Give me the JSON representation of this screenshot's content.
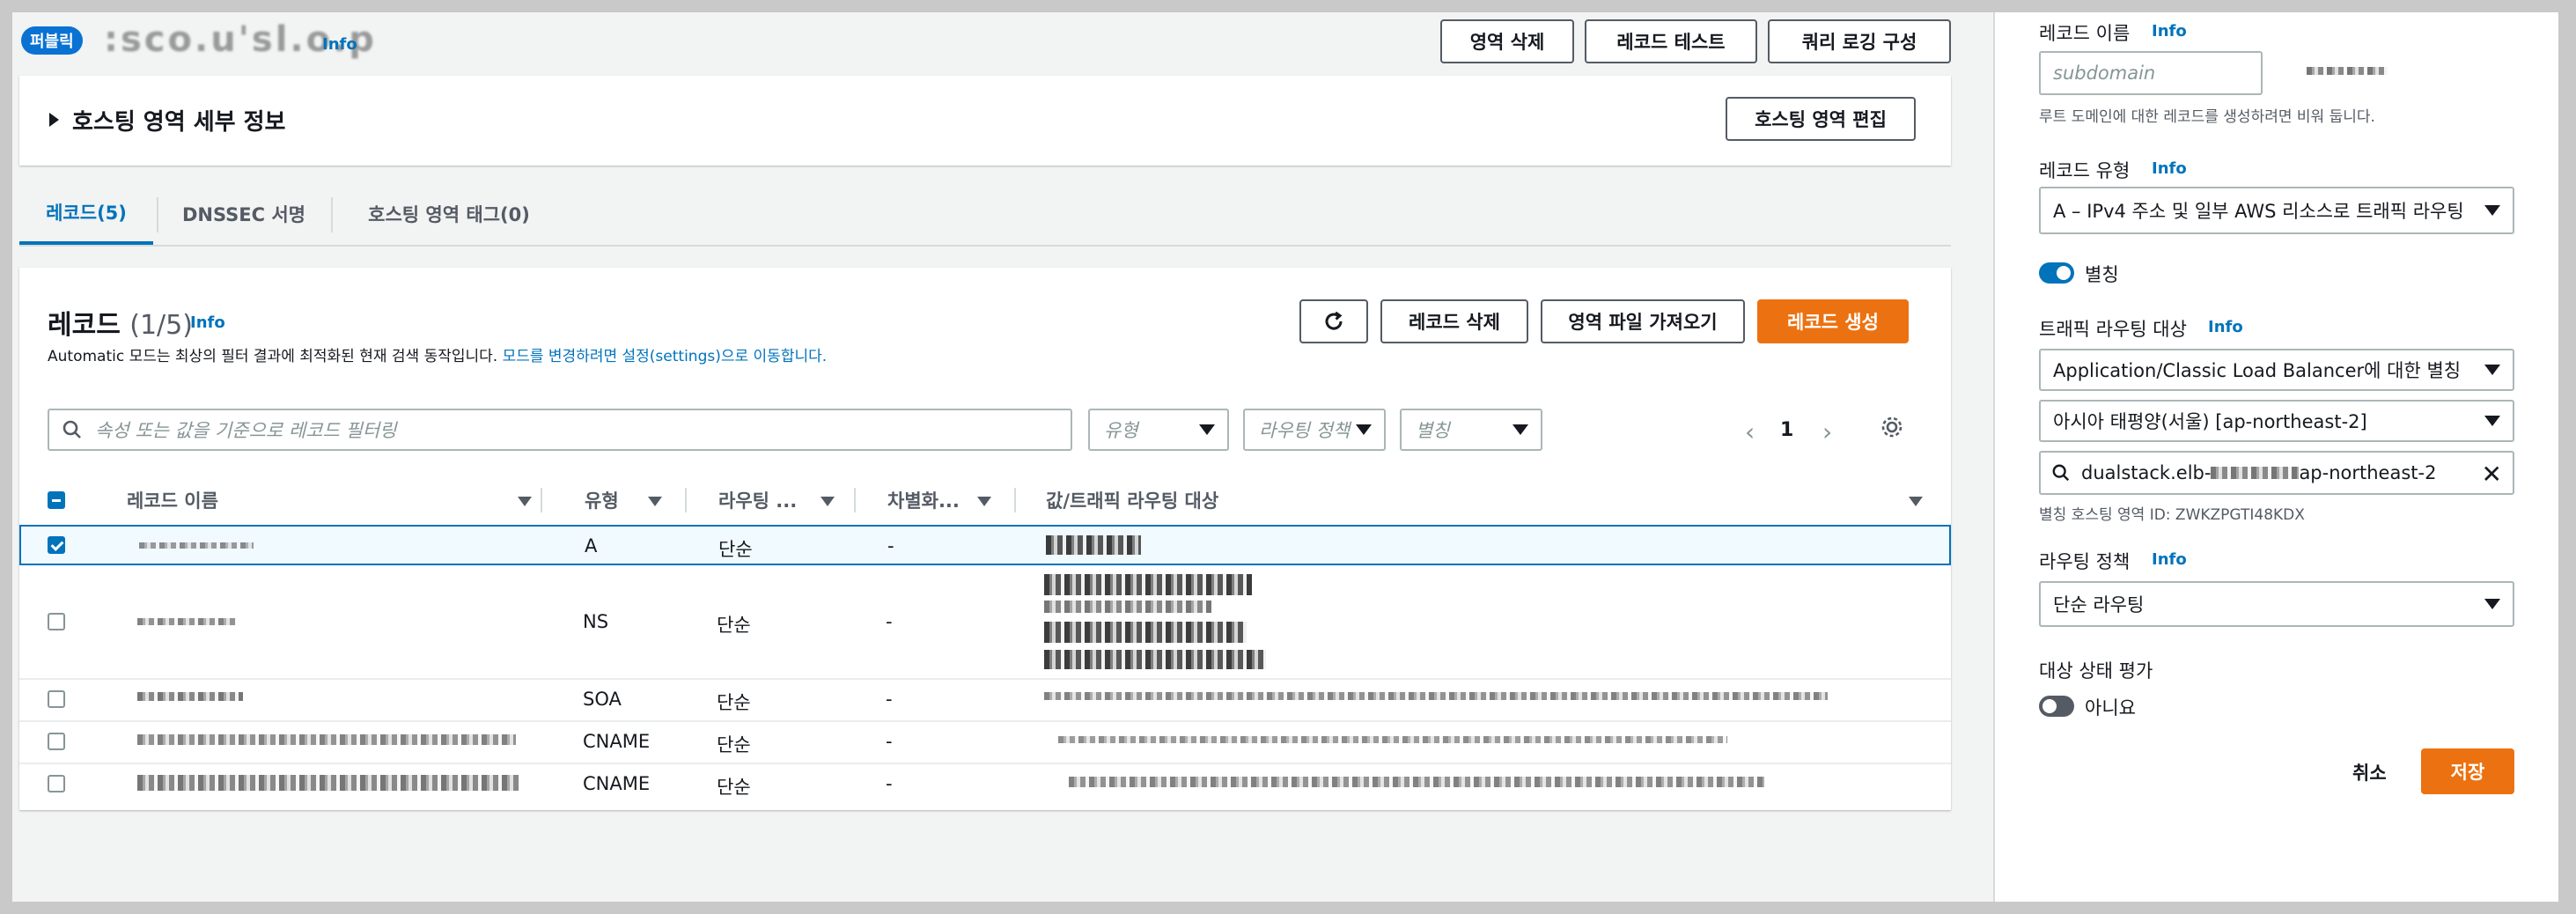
{
  "header": {
    "badge": "퍼블릭",
    "zone_name": ":sco.u'sl.o.p",
    "info": "Info",
    "buttons": {
      "delete_zone": "영역 삭제",
      "test_record": "레코드 테스트",
      "query_logging": "쿼리 로깅 구성"
    }
  },
  "details": {
    "title": "호스팅 영역 세부 정보",
    "edit_button": "호스팅 영역 편집"
  },
  "tabs": [
    {
      "label": "레코드(5)",
      "active": true
    },
    {
      "label": "DNSSEC 서명",
      "active": false
    },
    {
      "label": "호스팅 영역 태그(0)",
      "active": false
    }
  ],
  "records": {
    "title": "레코드",
    "count": "(1/5)",
    "info": "Info",
    "desc_text": "Automatic 모드는 최상의 필터 결과에 최적화된 현재 검색 동작입니다.",
    "desc_link": "모드를 변경하려면 설정(settings)으로 이동합니다.",
    "buttons": {
      "delete": "레코드 삭제",
      "import": "영역 파일 가져오기",
      "create": "레코드 생성"
    },
    "search_placeholder": "속성 또는 값을 기준으로 레코드 필터링",
    "filters": {
      "type": "유형",
      "routing": "라우팅 정책",
      "alias": "별칭"
    },
    "page": "1",
    "columns": [
      "레코드 이름",
      "유형",
      "라우팅 ...",
      "차별화...",
      "값/트래픽 라우팅 대상"
    ],
    "rows": [
      {
        "type": "A",
        "routing": "단순",
        "diff": "-",
        "selected": true
      },
      {
        "type": "NS",
        "routing": "단순",
        "diff": "-",
        "selected": false
      },
      {
        "type": "SOA",
        "routing": "단순",
        "diff": "-",
        "selected": false
      },
      {
        "type": "CNAME",
        "routing": "단순",
        "diff": "-",
        "selected": false
      },
      {
        "type": "CNAME",
        "routing": "단순",
        "diff": "-",
        "selected": false
      }
    ]
  },
  "panel": {
    "record_name_label": "레코드 이름",
    "info": "Info",
    "record_name_placeholder": "subdomain",
    "record_name_hint": "루트 도메인에 대한 레코드를 생성하려면 비워 둡니다.",
    "record_type_label": "레코드 유형",
    "record_type_value": "A – IPv4 주소 및 일부 AWS 리소스로 트래픽 라우팅",
    "alias_label": "별칭",
    "alias_on": true,
    "traffic_label": "트래픽 라우팅 대상",
    "endpoint_value": "Application/Classic Load Balancer에 대한 별칭",
    "region_value": "아시아 태평양(서울) [ap-northeast-2]",
    "lb_search_prefix": "dualstack.elb-",
    "lb_search_suffix": "ap-northeast-2",
    "alias_zone_id": "별칭 호스팅 영역 ID: ZWKZPGTI48KDX",
    "routing_policy_label": "라우팅 정책",
    "routing_policy_value": "단순 라우팅",
    "health_label": "대상 상태 평가",
    "health_value": "아니요",
    "health_on": false,
    "cancel": "취소",
    "save": "저장"
  },
  "colors": {
    "accent": "#ec7211",
    "link": "#0073bb",
    "selected_row": "#f1faff"
  }
}
